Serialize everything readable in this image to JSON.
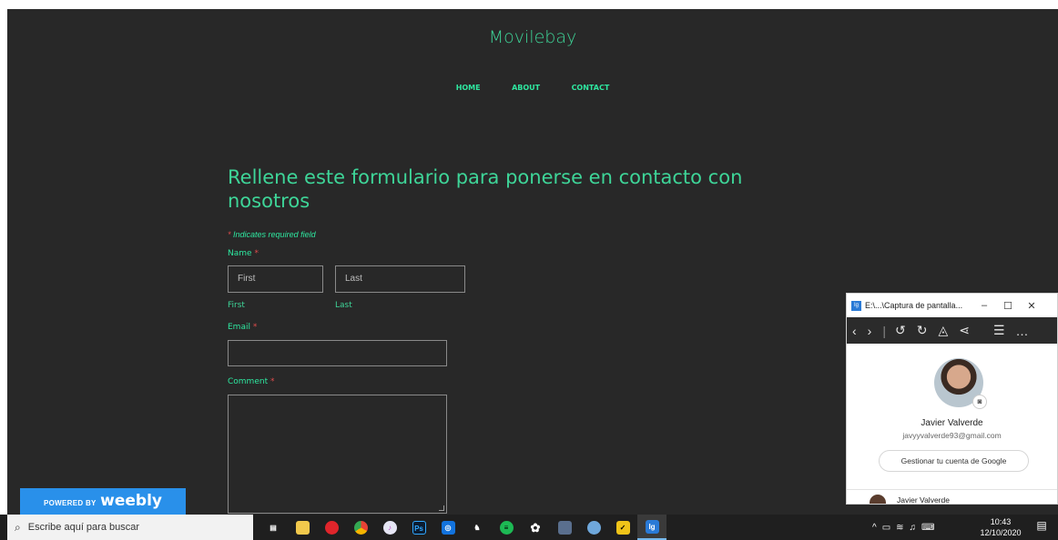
{
  "site": {
    "title": "Movilebay",
    "nav": [
      "HOME",
      "ABOUT",
      "CONTACT"
    ]
  },
  "form": {
    "heading": "Rellene este formulario para ponerse en contacto con nosotros",
    "required_note": "Indicates required field",
    "name_label": "Name",
    "first_placeholder": "First",
    "last_placeholder": "Last",
    "first_sublabel": "First",
    "last_sublabel": "Last",
    "email_label": "Email",
    "comment_label": "Comment",
    "asterisk": "*"
  },
  "badge": {
    "powered_by": "POWERED BY",
    "brand": "weebly"
  },
  "popup": {
    "title": "E:\\...\\Captura de pantalla...",
    "app_icon_text": "Ig",
    "name": "Javier Valverde",
    "email": "javyyvalverde93@gmail.com",
    "manage_button": "Gestionar tu cuenta de Google",
    "account_item": "Javier Valverde"
  },
  "taskbar": {
    "search_placeholder": "Escribe aquí para buscar",
    "ps_label": "Ps",
    "ig_label": "Ig",
    "time": "10:43",
    "date": "12/10/2020"
  }
}
